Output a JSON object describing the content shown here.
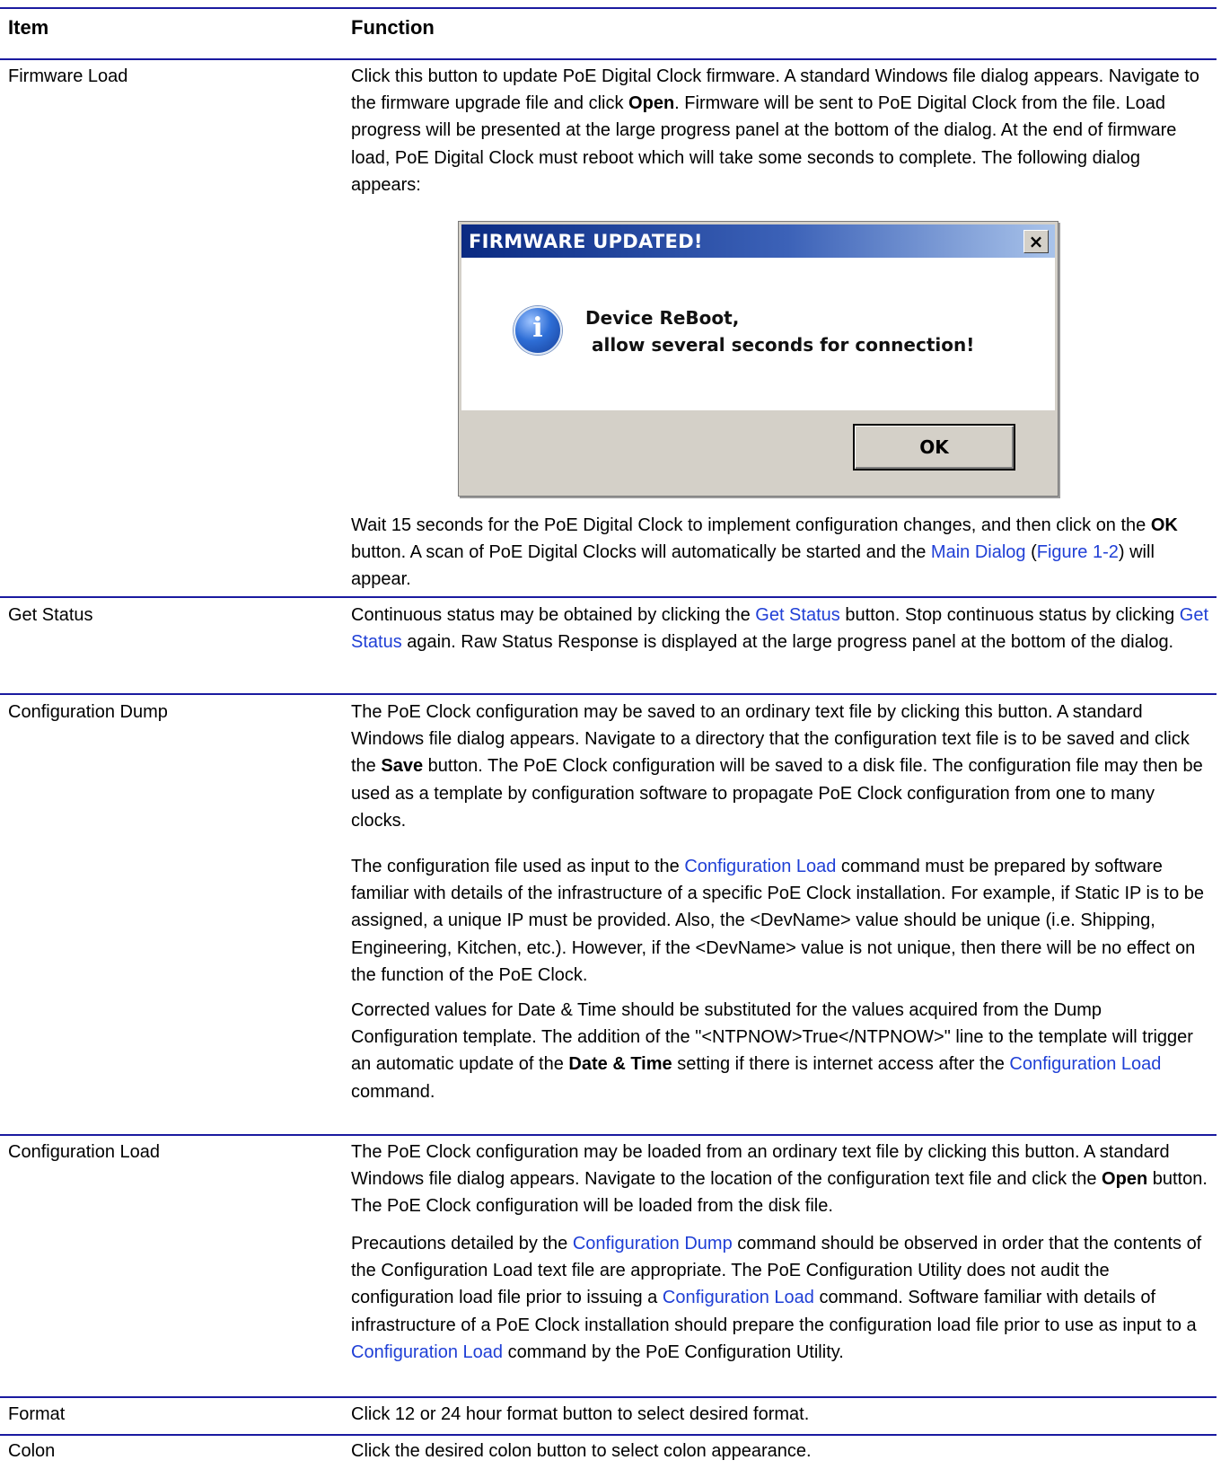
{
  "header": {
    "item": "Item",
    "function": "Function"
  },
  "rows": {
    "firmware": {
      "item": "Firmware Load",
      "p1a": "Click this button to update PoE Digital Clock firmware. A standard Windows file dialog appears. Navigate to the firmware upgrade file and click ",
      "p1b": "Open",
      "p1c": ". Firmware will be sent to PoE Digital Clock from the file. Load progress will be presented at the large progress panel at the bottom of the dialog. At the end of firmware load, PoE Digital Clock must reboot which will take some seconds to complete. The following dialog appears:",
      "p2a": "Wait 15 seconds for the PoE Digital Clock to implement configuration changes, and then click on the ",
      "p2b": "OK",
      "p2c": " button. A scan of PoE Digital Clocks will automatically be started and the ",
      "p2link1": "Main Dialog",
      "p2d": " (",
      "p2link2": "Figure 1-2",
      "p2e": ") will appear."
    },
    "status": {
      "item": "Get Status",
      "a": "Continuous status may be obtained by clicking the ",
      "link1": "Get Status",
      "b": " button. Stop continuous status by clicking ",
      "link2": "Get Status",
      "c": " again. Raw Status Response is displayed at the large progress panel at the bottom of the dialog."
    },
    "dump": {
      "item": "Configuration Dump",
      "p1a": "The PoE Clock configuration may be saved to an ordinary text file by clicking this button. A standard Windows file dialog appears. Navigate to a directory that the configuration text file is to be saved and click the ",
      "p1b": "Save",
      "p1c": " button. The PoE Clock configuration will be saved to a disk file. The configuration file may then be used as a template by configuration software to propagate PoE Clock configuration from one to many clocks.",
      "p2a": "The configuration file used as input to the ",
      "p2link": "Configuration Load",
      "p2b": " command must be prepared by software familiar with details of the infrastructure of a specific PoE Clock installation. For example, if Static IP is to be assigned, a unique IP must be provided. Also, the <DevName> value should be unique (i.e. Shipping, Engineering, Kitchen, etc.). However, if the <DevName> value is not unique, then there will be no effect on the function of the PoE Clock.",
      "p3a": "Corrected values for Date & Time should be substituted for the values acquired from the Dump Configuration template. The addition of the \"<NTPNOW>True</NTPNOW>\" line to the template will trigger an automatic update of the ",
      "p3b": "Date & Time",
      "p3c": " setting if there is internet access after the ",
      "p3link": "Configuration Load",
      "p3d": " command."
    },
    "load": {
      "item": "Configuration Load",
      "p1a": "The PoE Clock configuration may be loaded from an ordinary text file by clicking this button. A standard Windows file dialog appears. Navigate to the location of the configuration text file and click the ",
      "p1b": "Open",
      "p1c": " button. The PoE Clock configuration will be loaded from the disk file.",
      "p2a": "Precautions detailed by the ",
      "p2link1": "Configuration Dump",
      "p2b": " command should be observed in order that the contents of the Configuration Load text file are appropriate. The PoE Configuration Utility does not audit the configuration load file prior to issuing a ",
      "p2link2": "Configuration Load",
      "p2c": " command. Software familiar with details of infrastructure of a PoE Clock installation should prepare the configuration load file prior to use as input to a ",
      "p2link3": "Configuration Load",
      "p2d": " command by the PoE Configuration Utility."
    },
    "format": {
      "item": "Format",
      "text": "Click 12 or 24 hour format button to select desired format."
    },
    "colon": {
      "item": "Colon",
      "text": "Click the desired colon button to select colon appearance."
    }
  },
  "dialog": {
    "title": "FIRMWARE UPDATED!",
    "close": "×",
    "icon": "info-icon",
    "icon_glyph": "i",
    "message_line1": "Device ReBoot,",
    "message_line2": " allow several seconds for connection!",
    "ok_label": "OK"
  },
  "colors": {
    "rule": "#1a1aa0",
    "link": "#1f3fd6",
    "dialog_face": "#d4d0c8"
  }
}
